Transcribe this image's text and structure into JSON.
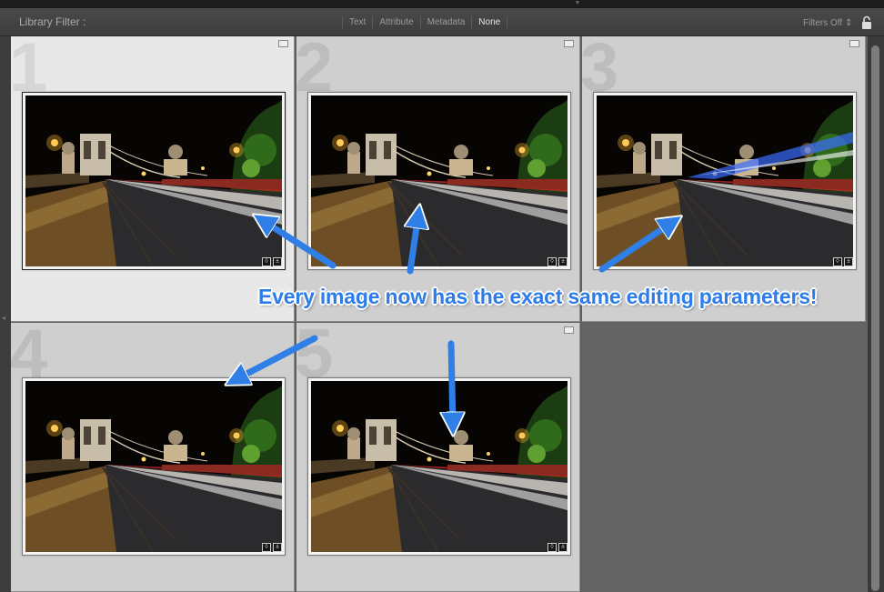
{
  "filter_bar": {
    "title": "Library Filter :",
    "tabs": [
      {
        "label": "Text",
        "active": false
      },
      {
        "label": "Attribute",
        "active": false
      },
      {
        "label": "Metadata",
        "active": false
      },
      {
        "label": "None",
        "active": true
      }
    ],
    "filters_status": "Filters Off",
    "lock_icon": "lock-icon"
  },
  "grid": {
    "cells": [
      {
        "number": "1",
        "selected": true
      },
      {
        "number": "2",
        "selected": false
      },
      {
        "number": "3",
        "selected": false
      },
      {
        "number": "4",
        "selected": false
      },
      {
        "number": "5",
        "selected": false
      }
    ]
  },
  "annotation": {
    "caption": "Every image now has the exact same editing parameters!",
    "arrow_color": "#2f7fe6"
  },
  "colors": {
    "background": "#5f5f5f",
    "cell_bg": "#cfcfcf",
    "cell_selected_bg": "#e8e8e8"
  }
}
